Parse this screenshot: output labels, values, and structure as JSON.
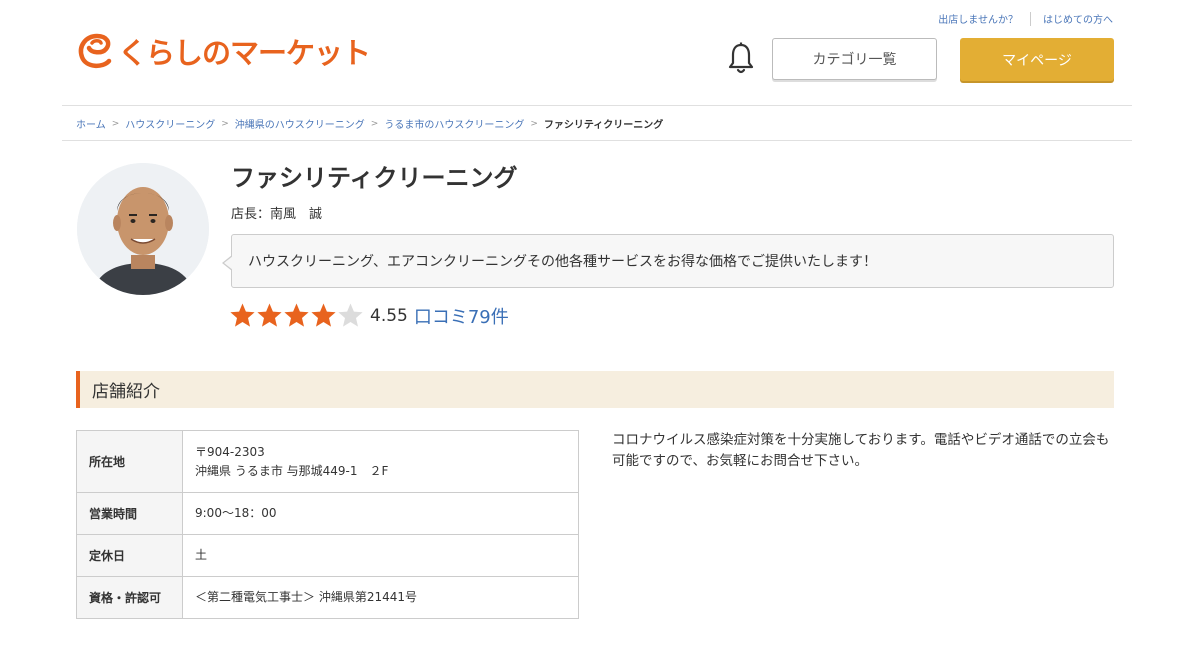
{
  "header": {
    "top_links": [
      "出店しませんか？",
      "はじめての方へ"
    ],
    "logo_text": "くらしのマーケット",
    "category_button": "カテゴリ一覧",
    "mypage_button": "マイページ",
    "brand_color": "#e8631e",
    "mypage_color": "#e3ae34"
  },
  "breadcrumb": {
    "items": [
      "ホーム",
      "ハウスクリーニング",
      "沖縄県のハウスクリーニング",
      "うるま市のハウスクリーニング"
    ],
    "separator": ">",
    "current": "ファシリティクリーニング"
  },
  "profile": {
    "shop_name": "ファシリティクリーニング",
    "manager": "店長：南風　誠",
    "message": "ハウスクリーニング、エアコンクリーニングその他各種サービスをお得な価格でご提供いたします！",
    "rating_value": "4.55",
    "rating_stars": 4.55,
    "review_link": "口コミ79件",
    "star_color": "#e8631e"
  },
  "section": {
    "title": "店舗紹介"
  },
  "info_table": {
    "rows": [
      {
        "label": "所在地",
        "lines": [
          "〒904-2303",
          "沖縄県 うるま市 与那城449-1　２F"
        ]
      },
      {
        "label": "営業時間",
        "lines": [
          "9:00〜18：00"
        ]
      },
      {
        "label": "定休日",
        "lines": [
          "土"
        ]
      },
      {
        "label": "資格・許認可",
        "lines": [
          "＜第二種電気工事士＞ 沖縄県第21441号"
        ]
      }
    ]
  },
  "description": {
    "lines": [
      "コロナウイルス感染症対策を十分実施しております。電話やビデオ通話での立会も",
      "可能ですので、お気軽にお問合せ下さい。"
    ]
  }
}
